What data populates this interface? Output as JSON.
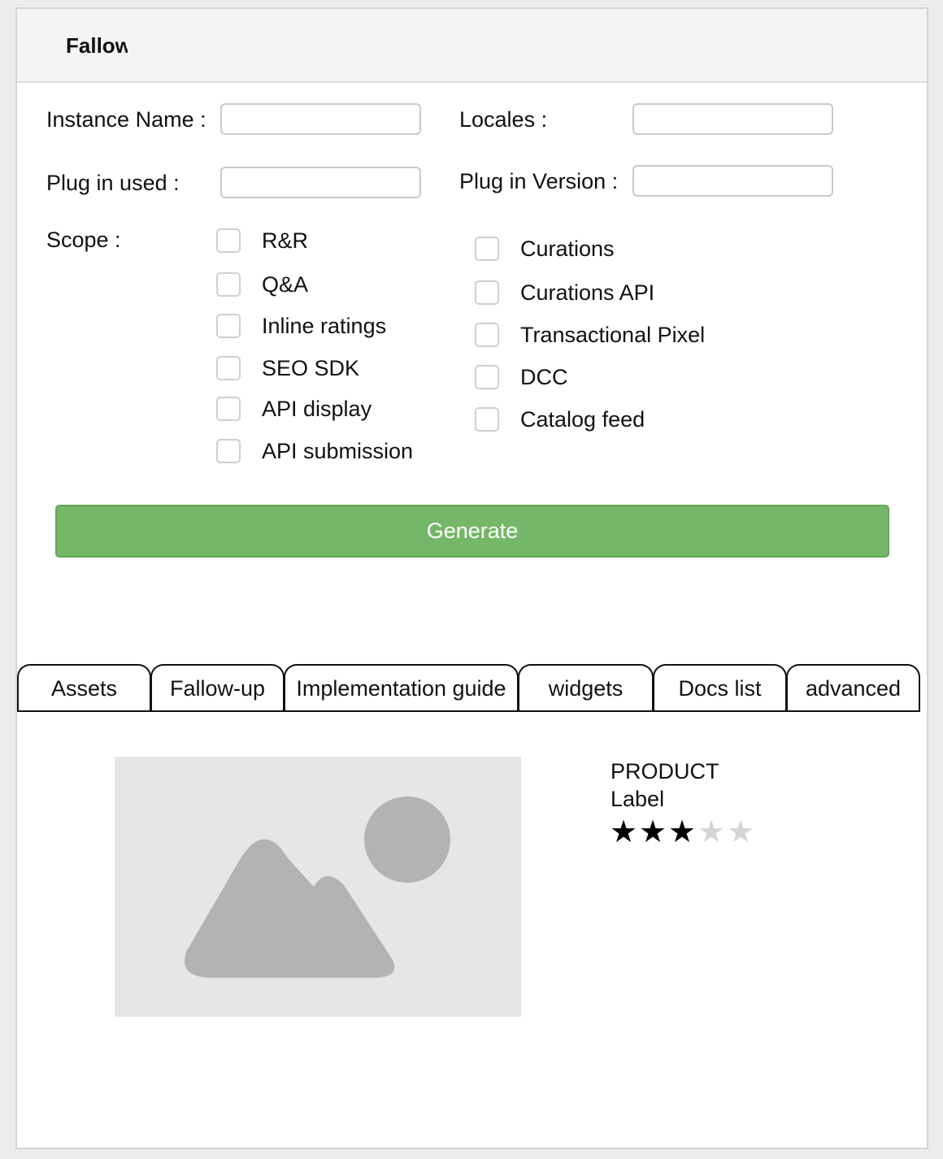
{
  "header": {
    "title": "Fallow"
  },
  "form": {
    "instance_name_label": "Instance Name :",
    "instance_name_value": "",
    "locales_label": "Locales :",
    "locales_value": "",
    "plugin_used_label": "Plug in used :",
    "plugin_used_value": "",
    "plugin_version_label": "Plug in Version :",
    "plugin_version_value": "",
    "scope_label": "Scope :",
    "scope_left": [
      {
        "label": "R&R",
        "checked": false
      },
      {
        "label": "Q&A",
        "checked": false
      },
      {
        "label": "Inline ratings",
        "checked": false
      },
      {
        "label": "SEO SDK",
        "checked": false
      },
      {
        "label": "API display",
        "checked": false
      },
      {
        "label": "API submission",
        "checked": false
      }
    ],
    "scope_right": [
      {
        "label": "Curations",
        "checked": false
      },
      {
        "label": "Curations API",
        "checked": false
      },
      {
        "label": "Transactional Pixel",
        "checked": false
      },
      {
        "label": "DCC",
        "checked": false
      },
      {
        "label": "Catalog feed",
        "checked": false
      }
    ],
    "generate_label": "Generate"
  },
  "colors": {
    "generate_button": "#75b768",
    "header_background": "#f4f4f4",
    "image_placeholder": "#e6e6e6",
    "placeholder_shapes": "#b3b3b3"
  },
  "tabs": [
    {
      "label": "Assets"
    },
    {
      "label": "Fallow-up"
    },
    {
      "label": "Implementation guide"
    },
    {
      "label": "widgets"
    },
    {
      "label": "Docs list"
    },
    {
      "label": "advanced"
    }
  ],
  "product": {
    "image_icon": "image-placeholder-icon",
    "title": "PRODUCT",
    "label": "Label",
    "rating": 3,
    "rating_max": 5
  }
}
